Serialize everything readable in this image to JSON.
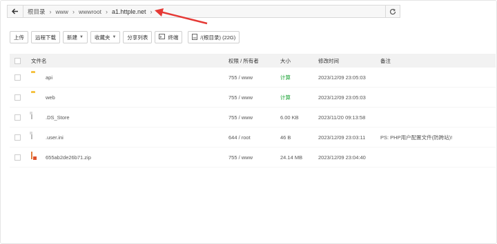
{
  "breadcrumb": {
    "items": [
      "根目录",
      "www",
      "wwwroot",
      "a1.httple.net"
    ]
  },
  "toolbar": {
    "upload": "上传",
    "remote_download": "远程下载",
    "new": "新建",
    "favorites": "收藏夹",
    "share_list": "分享列表",
    "terminal": "终端",
    "disk": "/(根目录) (22G)"
  },
  "table": {
    "headers": {
      "name": "文件名",
      "perm": "权限 / 所有者",
      "size": "大小",
      "time": "修改时间",
      "note": "备注"
    },
    "rows": [
      {
        "name": "api",
        "type": "folder",
        "perm": "755 / www",
        "size": "计算",
        "time": "2023/12/09 23:05:03",
        "note": ""
      },
      {
        "name": "web",
        "type": "folder",
        "perm": "755 / www",
        "size": "计算",
        "time": "2023/12/09 23:05:03",
        "note": ""
      },
      {
        "name": ".DS_Store",
        "type": "file",
        "perm": "755 / www",
        "size": "6.00 KB",
        "time": "2023/11/20 09:13:58",
        "note": ""
      },
      {
        "name": ".user.ini",
        "type": "file",
        "perm": "644 / root",
        "size": "46 B",
        "time": "2023/12/09 23:03:11",
        "note": "PS: PHP用户配置文件(防跨站)!"
      },
      {
        "name": "655ab2de26b71.zip",
        "type": "zip",
        "perm": "755 / www",
        "size": "24.14 MB",
        "time": "2023/12/09 23:04:40",
        "note": ""
      }
    ]
  },
  "colors": {
    "calc_green": "#20a53a",
    "annotation_arrow": "#e53935"
  }
}
